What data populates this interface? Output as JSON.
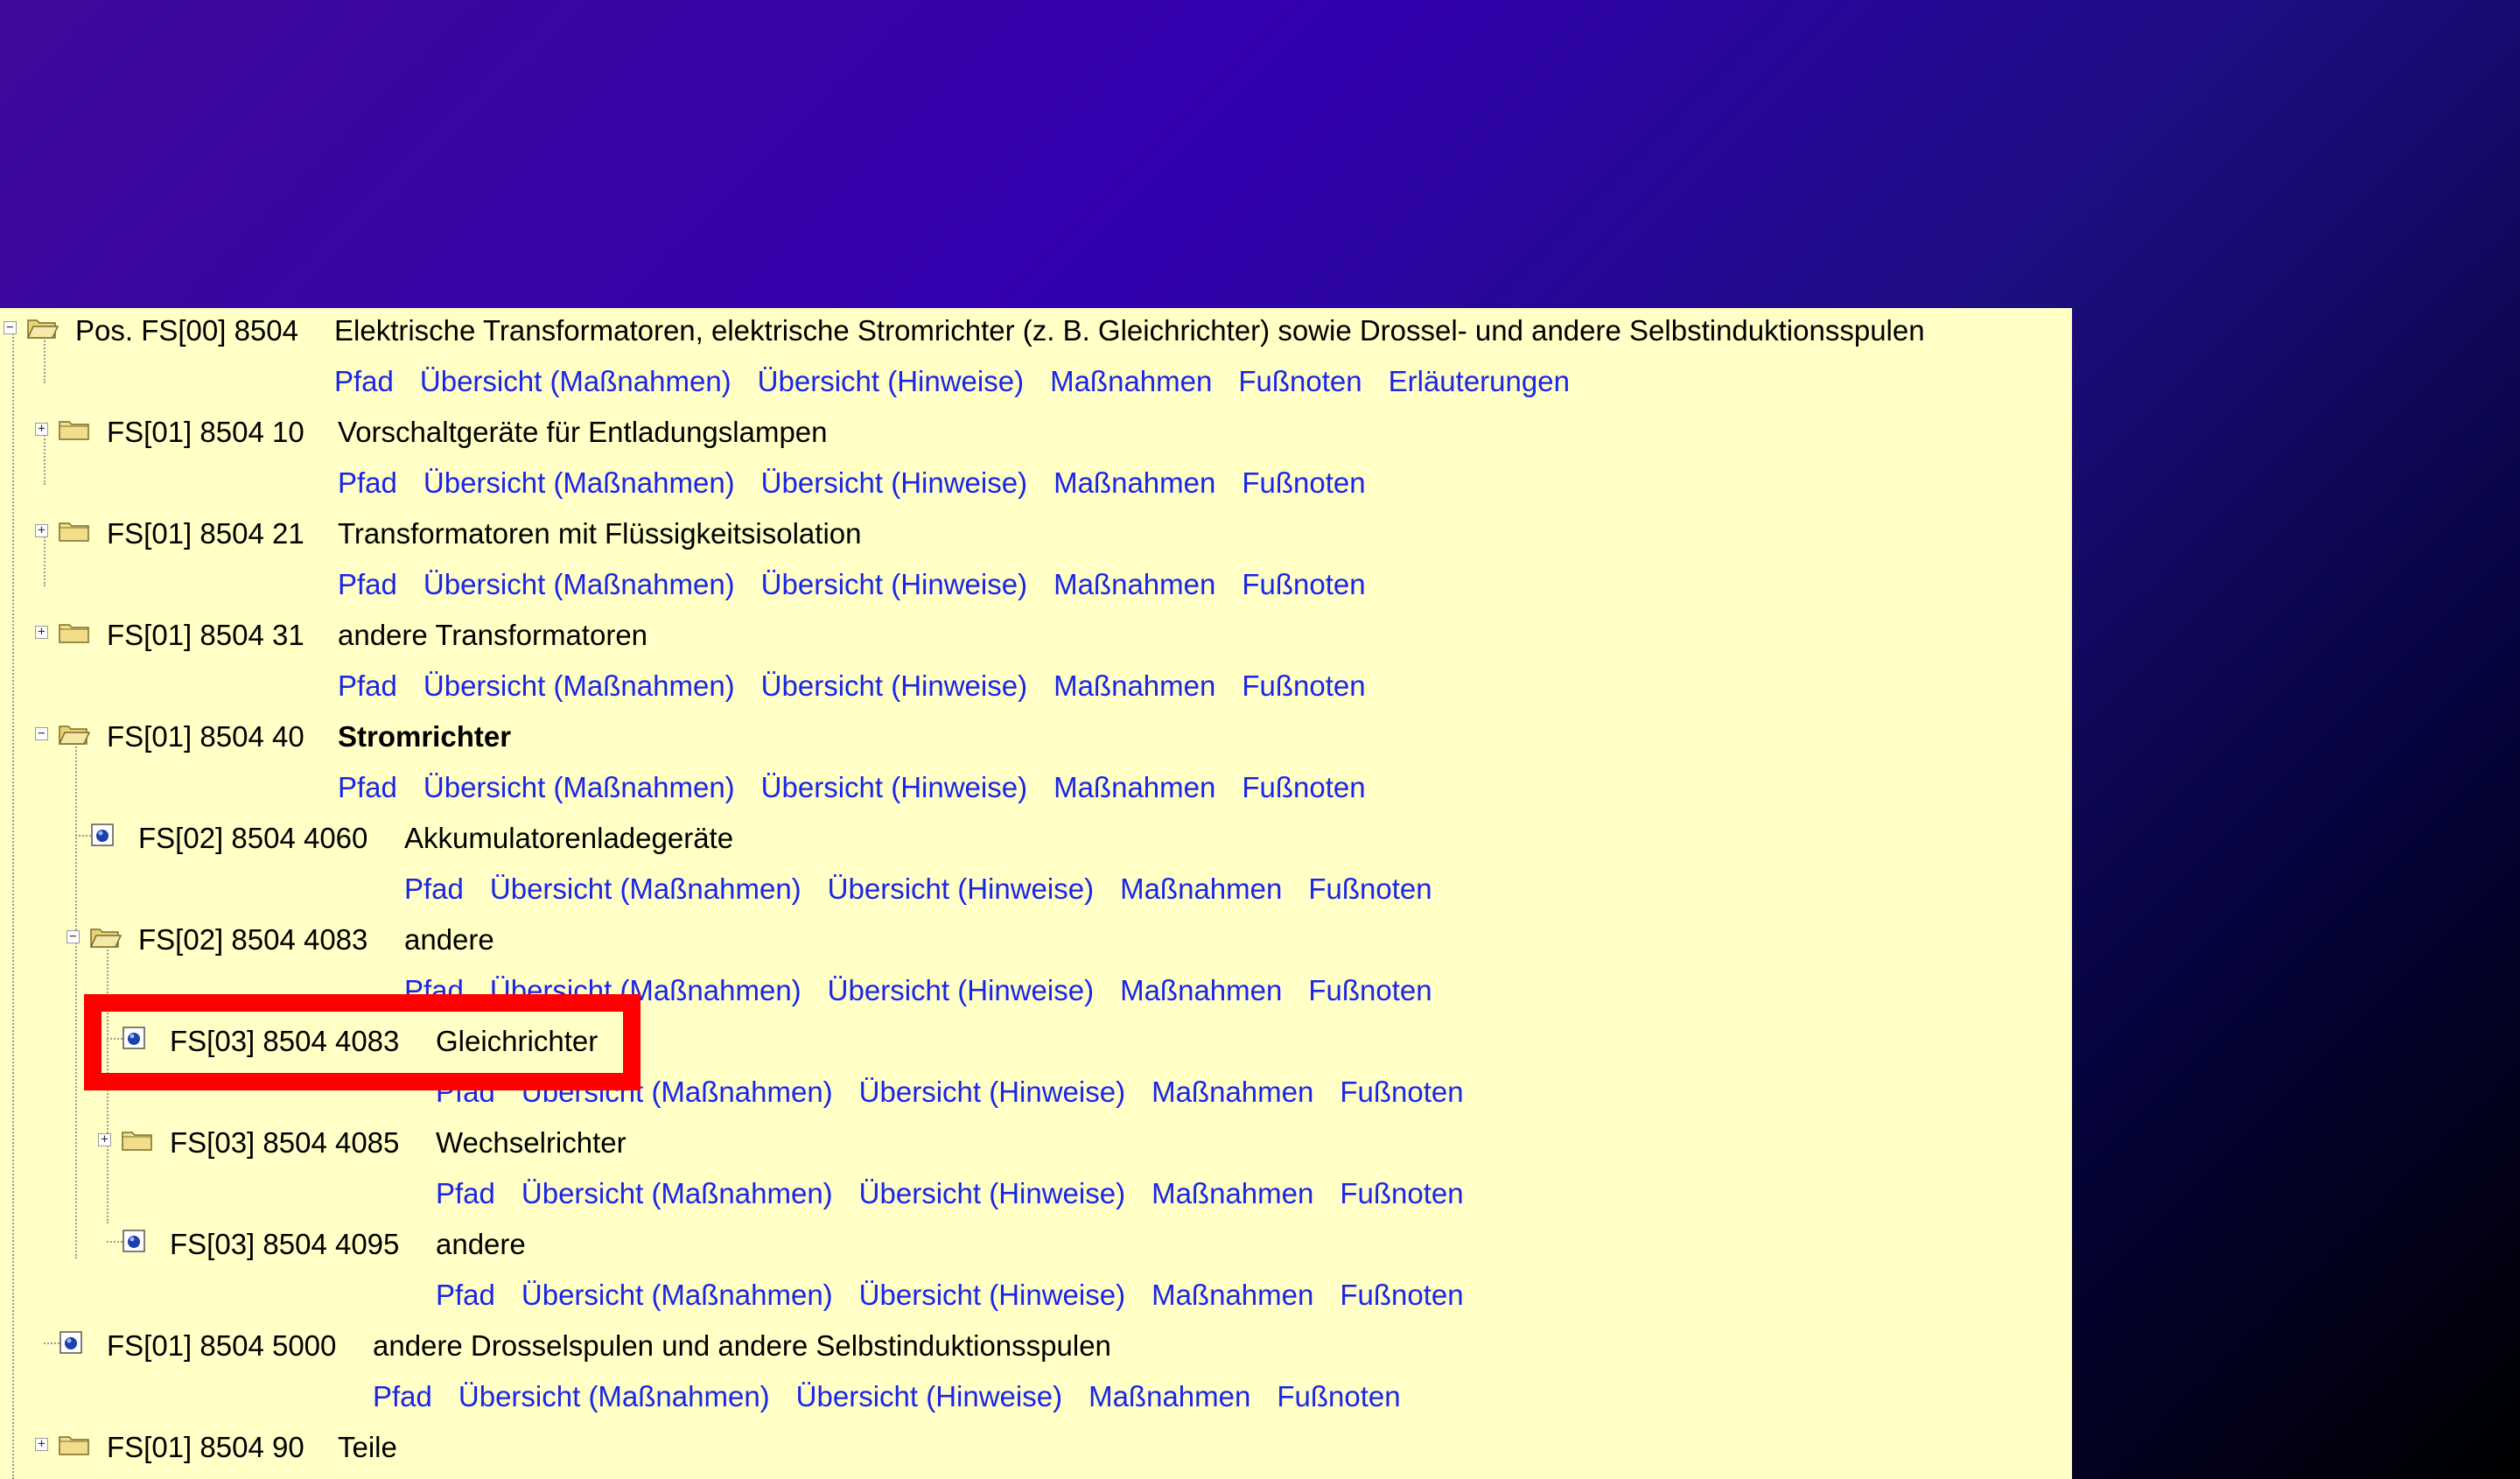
{
  "root": {
    "code": "Pos. FS[00] 8504",
    "title": "Elektrische Transformatoren, elektrische Stromrichter (z. B. Gleichrichter) sowie Drossel- und andere Selbstinduktionsspulen"
  },
  "links_root": [
    "Pfad",
    "Übersicht (Maßnahmen)",
    "Übersicht (Hinweise)",
    "Maßnahmen",
    "Fußnoten",
    "Erläuterungen"
  ],
  "links": [
    "Pfad",
    "Übersicht (Maßnahmen)",
    "Übersicht (Hinweise)",
    "Maßnahmen",
    "Fußnoten"
  ],
  "expander_plus": "+",
  "expander_minus": "−",
  "nodes": [
    {
      "code": "FS[01] 8504 10",
      "title": "Vorschaltgeräte für Entladungslampen"
    },
    {
      "code": "FS[01] 8504 21",
      "title": "Transformatoren mit Flüssigkeitsisolation"
    },
    {
      "code": "FS[01] 8504 31",
      "title": "andere Transformatoren"
    },
    {
      "code": "FS[01] 8504 40",
      "title": "Stromrichter"
    },
    {
      "code": "FS[02] 8504 4060",
      "title": "Akkumulatorenladegeräte"
    },
    {
      "code": "FS[02] 8504 4083",
      "title": "andere"
    },
    {
      "code": "FS[03] 8504 4083",
      "title": "Gleichrichter"
    },
    {
      "code": "FS[03] 8504 4085",
      "title": "Wechselrichter"
    },
    {
      "code": "FS[03] 8504 4095",
      "title": "andere"
    },
    {
      "code": "FS[01] 8504 5000",
      "title": "andere Drosselspulen und andere Selbstinduktionsspulen"
    },
    {
      "code": "FS[01] 8504 90",
      "title": "Teile"
    }
  ],
  "colors": {
    "panel_bg": "#ffffc6",
    "link": "#1a25e8",
    "highlight": "#ff0000"
  }
}
